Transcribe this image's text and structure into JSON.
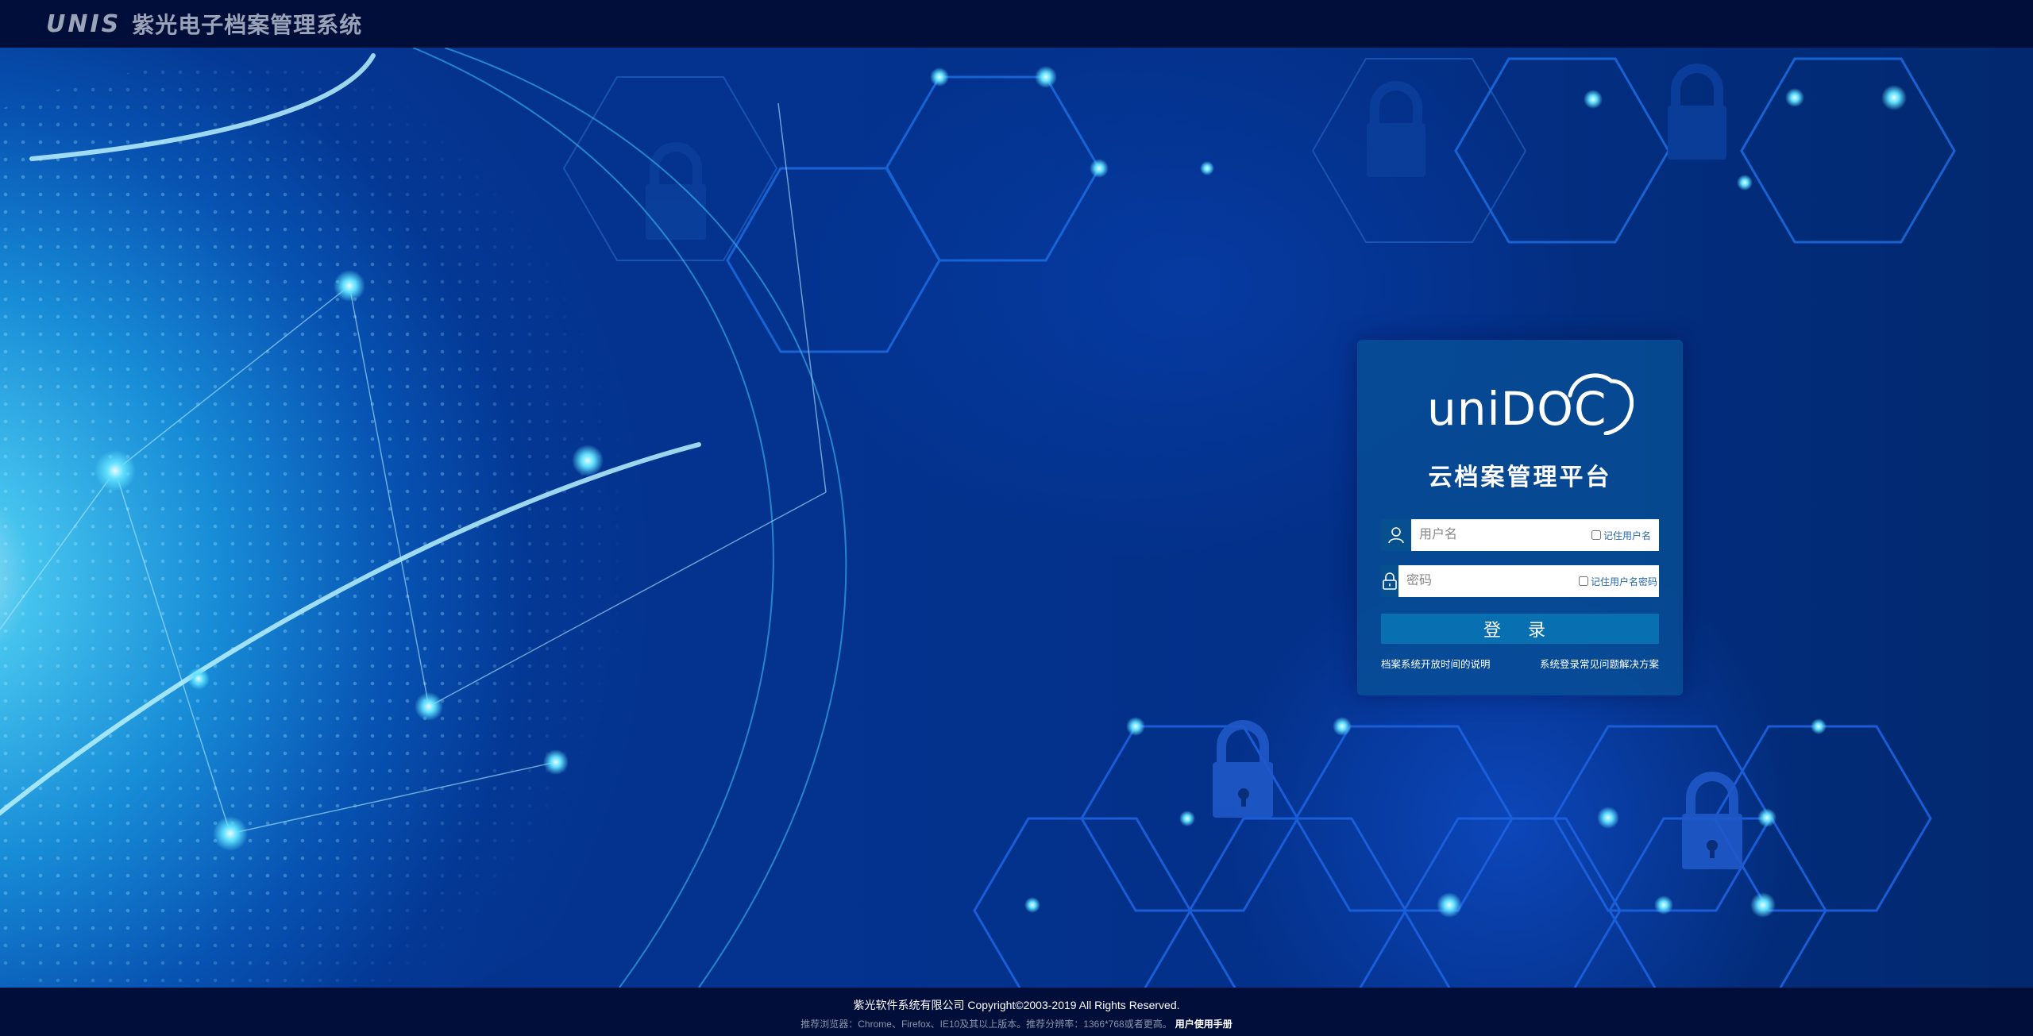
{
  "header": {
    "brand_logo": "UNIS",
    "system_title": "紫光电子档案管理系统"
  },
  "login": {
    "product_logo_text": "uniDOC",
    "platform_title": "云档案管理平台",
    "username_placeholder": "用户名",
    "remember_username_label": "记住用户名",
    "password_placeholder": "密码",
    "remember_password_label": "记住用户名密码",
    "login_button": "登 录",
    "link_open_hours": "档案系统开放时间的说明",
    "link_faq": "系统登录常见问题解决方案"
  },
  "footer": {
    "copyright": "紫光软件系统有限公司 Copyright©2003-2019 All Rights Reserved.",
    "browser_note": "推荐浏览器：Chrome、Firefox、IE10及其以上版本。推荐分辨率：1366*768或者更高。",
    "manual_link": "用户使用手册"
  },
  "colors": {
    "header_bg": "#010e3a",
    "hero_bg": "#03338f",
    "panel_bg": "#08508f",
    "button_bg": "#086fb0",
    "accent_cyan": "#3fd6ff"
  },
  "icons": [
    "user-icon",
    "lock-icon",
    "cloud-icon",
    "padlock-icon"
  ]
}
